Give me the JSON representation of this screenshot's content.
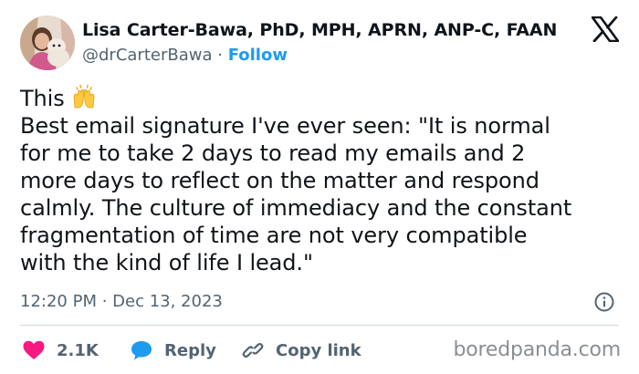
{
  "author": {
    "display_name": "Lisa Carter-Bawa, PhD, MPH, APRN, ANP-C, FAAN",
    "handle": "@drCarterBawa",
    "separator": "·",
    "follow_label": "Follow"
  },
  "tweet": {
    "line_this": "This",
    "emoji_icon": "raising-hands-emoji",
    "text": "Best email signature I've ever seen: \"It is normal\nfor me to take 2 days to read my emails and 2\nmore days to reflect on the matter and respond\ncalmly. The culture of immediacy and the constant\nfragmentation of time are not very compatible\nwith the kind of life I lead.\"",
    "timestamp": "12:20 PM · Dec 13, 2023"
  },
  "actions": {
    "like_count": "2.1K",
    "reply_label": "Reply",
    "copy_label": "Copy link"
  },
  "watermark": "boredpanda.com",
  "colors": {
    "accent": "#1d9bf0",
    "like": "#f91880",
    "muted": "#536471",
    "text": "#0f1419"
  }
}
